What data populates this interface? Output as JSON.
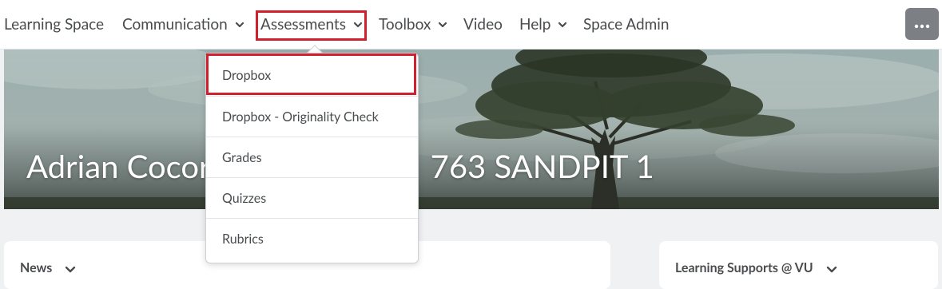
{
  "nav": {
    "items": [
      {
        "label": "Learning Space",
        "has_menu": false
      },
      {
        "label": "Communication",
        "has_menu": true
      },
      {
        "label": "Assessments",
        "has_menu": true,
        "highlighted": true
      },
      {
        "label": "Toolbox",
        "has_menu": true
      },
      {
        "label": "Video",
        "has_menu": false
      },
      {
        "label": "Help",
        "has_menu": true
      },
      {
        "label": "Space Admin",
        "has_menu": false
      }
    ],
    "more_icon": "ellipsis-icon"
  },
  "banner": {
    "title_left": "Adrian Cocor",
    "title_right": "763 SANDPIT 1"
  },
  "assessments_menu": {
    "items": [
      {
        "label": "Dropbox",
        "highlighted": true
      },
      {
        "label": "Dropbox - Originality Check"
      },
      {
        "label": "Grades"
      },
      {
        "label": "Quizzes"
      },
      {
        "label": "Rubrics"
      }
    ]
  },
  "widgets": {
    "news": {
      "title": "News"
    },
    "learning_supports": {
      "title": "Learning Supports @ VU"
    }
  },
  "colors": {
    "highlight": "#d0202e",
    "nav_text": "#494c4e",
    "more_button": "#7c8085"
  }
}
